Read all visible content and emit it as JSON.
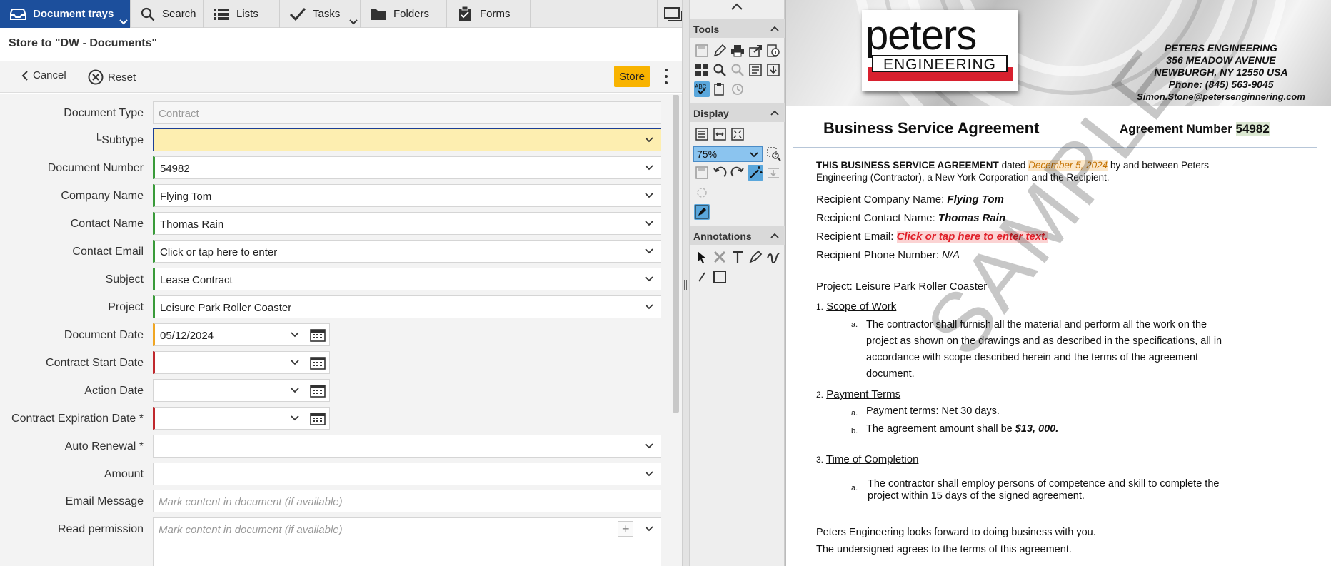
{
  "nav": {
    "tabs": [
      {
        "label": "Document trays",
        "icon": "tray-icon"
      },
      {
        "label": "Search",
        "icon": "search-icon"
      },
      {
        "label": "Lists",
        "icon": "list-icon"
      },
      {
        "label": "Tasks",
        "icon": "check-icon"
      },
      {
        "label": "Folders",
        "icon": "folder-icon"
      },
      {
        "label": "Forms",
        "icon": "clipboard-icon"
      }
    ],
    "window_icon": "window-icon"
  },
  "form": {
    "title": "Store to \"DW - Documents\"",
    "toolbar": {
      "cancel": "Cancel",
      "reset": "Reset",
      "store": "Store"
    },
    "fields": [
      {
        "label": "Document Type",
        "value": "Contract"
      },
      {
        "label": "└Subtype",
        "value": ""
      },
      {
        "label": "Document Number",
        "value": "54982"
      },
      {
        "label": "Company Name",
        "value": "Flying Tom"
      },
      {
        "label": "Contact Name",
        "value": "Thomas Rain"
      },
      {
        "label": "Contact Email",
        "value": "Click or tap here to enter"
      },
      {
        "label": "Subject",
        "value": "Lease Contract"
      },
      {
        "label": "Project",
        "value": "Leisure Park Roller Coaster"
      },
      {
        "label": "Document Date",
        "value": "05/12/2024"
      },
      {
        "label": "Contract Start Date",
        "value": ""
      },
      {
        "label": "Action Date",
        "value": ""
      },
      {
        "label": "Contract Expiration Date *",
        "value": ""
      },
      {
        "label": "Auto Renewal *",
        "value": ""
      },
      {
        "label": "Amount",
        "value": ""
      },
      {
        "label": "Email Message",
        "placeholder": "Mark content in document (if available)"
      },
      {
        "label": "Read permission",
        "placeholder": "Mark content in document (if available)"
      }
    ]
  },
  "tools_panel": {
    "sections": {
      "tools": "Tools",
      "display": "Display",
      "annotations": "Annotations"
    },
    "zoom": "75%"
  },
  "document": {
    "logo_word": "peters",
    "logo_sub": "ENGINEERING",
    "address": [
      "PETERS ENGINEERING",
      "356 MEADOW AVENUE",
      "NEWBURGH, NY 12550 USA",
      "Phone: (845) 563-9045",
      "Simon.Stone@petersenginnering.com"
    ],
    "title": "Business Service Agreement",
    "agreement_label": "Agreement Number",
    "agreement_number": "54982",
    "intro_bold": "THIS BUSINESS SERVICE AGREEMENT",
    "intro_dated": "dated",
    "intro_date": "December 5, 2024",
    "intro_rest_1": "by and between Peters",
    "intro_rest_2": "Engineering (Contractor), a New York Corporation and the Recipient.",
    "company_label": "Recipient Company Name:",
    "company_value": "Flying Tom",
    "contact_label": "Recipient Contact Name:",
    "contact_value": "Thomas Rain",
    "email_label": "Recipient Email:",
    "email_value": "Click or tap here to enter text.",
    "phone_label": "Recipient Phone Number:",
    "phone_value": "N/A",
    "project": "Project: Leisure Park Roller Coaster",
    "s1_num": "1.",
    "s1_title": "Scope of Work",
    "s1a_mark": "a.",
    "s1a": [
      "The contractor shall furnish all the material and perform all the work on the",
      "project as shown on the drawings and as described in the specifications, all in",
      "accordance with scope described herein and the terms of the agreement",
      "document."
    ],
    "s2_num": "2.",
    "s2_title": "Payment Terms",
    "s2a_mark": "a.",
    "s2a": "Payment terms: Net 30 days.",
    "s2b_mark": "b.",
    "s2b_pre": "The agreement amount shall be",
    "s2b_amount": "$13, 000.",
    "s3_num": "3.",
    "s3_title": "Time of Completion",
    "s3a_mark": "a.",
    "s3a": [
      "The contractor shall employ persons of competence and skill to complete the",
      "project within 15 days of the signed agreement."
    ],
    "closing_1": "Peters Engineering looks forward to doing business with you.",
    "closing_2": "The undersigned agrees to the terms of this agreement.",
    "watermark": "SAMPLE"
  }
}
